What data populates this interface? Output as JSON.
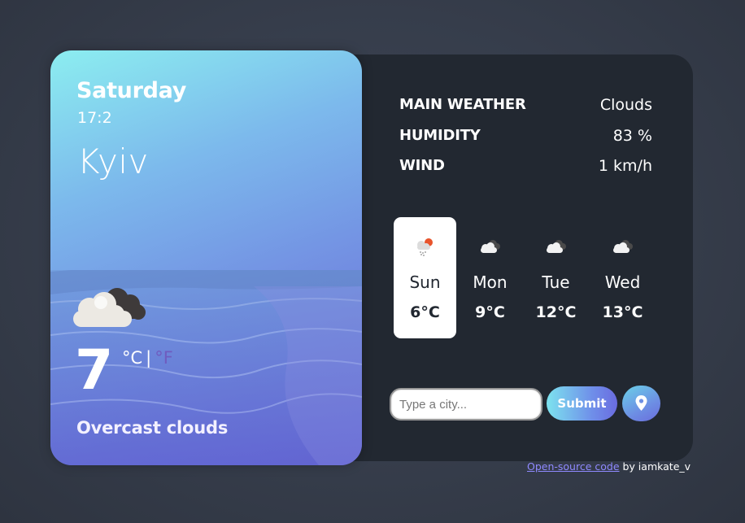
{
  "left_card": {
    "day": "Saturday",
    "time": "17:2",
    "city": "Kyiv",
    "temperature": "7",
    "unit_c": "°C",
    "unit_separator": "|",
    "unit_f": "°F",
    "description": "Overcast clouds",
    "weather_icon": "cloud-icon"
  },
  "details": {
    "main_weather": {
      "label": "MAIN WEATHER",
      "value": "Clouds"
    },
    "humidity": {
      "label": "HUMIDITY",
      "value": "83 %"
    },
    "wind": {
      "label": "WIND",
      "value": "1 km/h"
    }
  },
  "forecast": [
    {
      "day": "Sun",
      "temp": "6°C",
      "icon": "cloud-rain-sun-icon",
      "active": true
    },
    {
      "day": "Mon",
      "temp": "9°C",
      "icon": "cloud-icon",
      "active": false
    },
    {
      "day": "Tue",
      "temp": "12°C",
      "icon": "cloud-icon",
      "active": false
    },
    {
      "day": "Wed",
      "temp": "13°C",
      "icon": "cloud-icon",
      "active": false
    }
  ],
  "search": {
    "placeholder": "Type a city...",
    "value": "",
    "submit_label": "Submit",
    "location_icon": "location-pin-icon"
  },
  "footer": {
    "link_text": "Open-source code",
    "by_text": " by iamkate_v"
  },
  "colors": {
    "background": "#363d4b",
    "panel": "#222831",
    "accent_purple": "#6f5cbf",
    "link": "#8f89ff"
  }
}
